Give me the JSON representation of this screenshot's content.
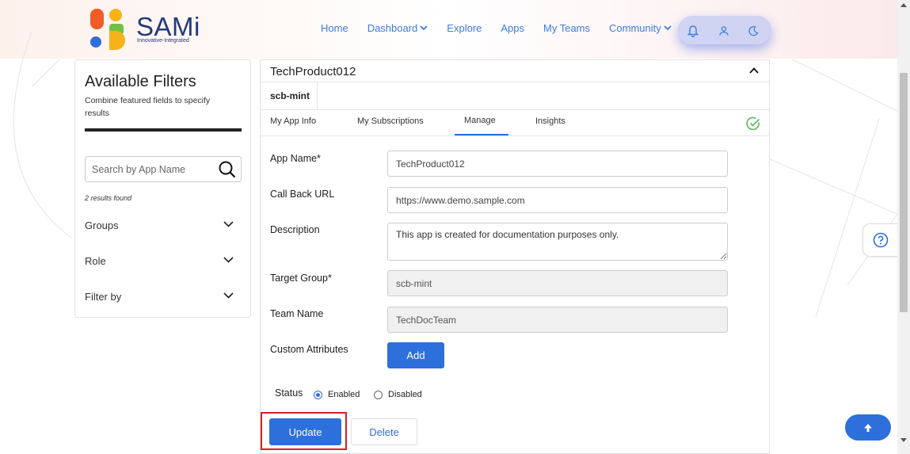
{
  "header": {
    "logo": {
      "name": "SAMi",
      "tagline": "Innovative-Integrated"
    },
    "nav": [
      {
        "label": "Home",
        "dropdown": false
      },
      {
        "label": "Dashboard",
        "dropdown": true
      },
      {
        "label": "Explore",
        "dropdown": false
      },
      {
        "label": "Apps",
        "dropdown": false
      },
      {
        "label": "My Teams",
        "dropdown": false
      },
      {
        "label": "Community",
        "dropdown": true
      }
    ],
    "icons": [
      "bell-icon",
      "user-icon",
      "moon-icon"
    ]
  },
  "filters": {
    "title": "Available Filters",
    "subtitle": "Combine featured fields to specify results",
    "search_placeholder": "Search by App Name",
    "results_found": "2 results found",
    "items": [
      {
        "label": "Groups"
      },
      {
        "label": "Role"
      },
      {
        "label": "Filter by"
      }
    ]
  },
  "app_card": {
    "title": "TechProduct012",
    "group_tab": "scb-mint",
    "tabs": [
      {
        "label": "My App Info",
        "active": false
      },
      {
        "label": "My Subscriptions",
        "active": false
      },
      {
        "label": "Manage",
        "active": true
      },
      {
        "label": "Insights",
        "active": false
      }
    ],
    "form": {
      "app_name_label": "App Name*",
      "app_name_value": "TechProduct012",
      "callback_label": "Call Back URL",
      "callback_value": "https://www.demo.sample.com",
      "description_label": "Description",
      "description_value": "This app is created for documentation purposes only.",
      "target_group_label": "Target Group*",
      "target_group_value": "scb-mint",
      "team_name_label": "Team Name",
      "team_name_value": "TechDocTeam",
      "custom_attributes_label": "Custom Attributes",
      "add_label": "Add",
      "status_label": "Status",
      "status_options": [
        "Enabled",
        "Disabled"
      ],
      "status_selected": "Enabled",
      "update_label": "Update",
      "delete_label": "Delete"
    }
  },
  "colors": {
    "primary": "#2d6fdb",
    "nav_link": "#3b7be0",
    "highlight": "#d62020",
    "success": "#5cb85c",
    "logo_orange": "#f25c27",
    "logo_yellow": "#f6b319",
    "logo_blue": "#2d6fdb",
    "logo_green": "#74c043"
  }
}
